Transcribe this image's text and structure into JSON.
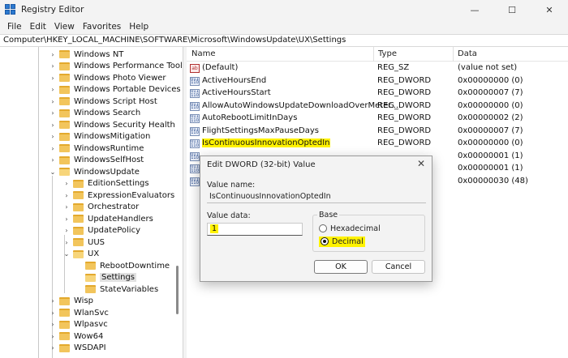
{
  "window": {
    "title": "Registry Editor",
    "min_glyph": "—",
    "max_glyph": "☐",
    "close_glyph": "✕"
  },
  "menu": [
    "File",
    "Edit",
    "View",
    "Favorites",
    "Help"
  ],
  "address": "Computer\\HKEY_LOCAL_MACHINE\\SOFTWARE\\Microsoft\\WindowsUpdate\\UX\\Settings",
  "tree": [
    {
      "label": "Windows NT",
      "level": 0,
      "expanded": false
    },
    {
      "label": "Windows Performance Toolkit",
      "level": 0,
      "expanded": false
    },
    {
      "label": "Windows Photo Viewer",
      "level": 0,
      "expanded": false
    },
    {
      "label": "Windows Portable Devices",
      "level": 0,
      "expanded": false
    },
    {
      "label": "Windows Script Host",
      "level": 0,
      "expanded": false
    },
    {
      "label": "Windows Search",
      "level": 0,
      "expanded": false
    },
    {
      "label": "Windows Security Health",
      "level": 0,
      "expanded": false
    },
    {
      "label": "WindowsMitigation",
      "level": 0,
      "expanded": false
    },
    {
      "label": "WindowsRuntime",
      "level": 0,
      "expanded": false
    },
    {
      "label": "WindowsSelfHost",
      "level": 0,
      "expanded": false
    },
    {
      "label": "WindowsUpdate",
      "level": 0,
      "expanded": true
    },
    {
      "label": "EditionSettings",
      "level": 1,
      "expanded": false
    },
    {
      "label": "ExpressionEvaluators",
      "level": 1,
      "expanded": false
    },
    {
      "label": "Orchestrator",
      "level": 1,
      "expanded": false
    },
    {
      "label": "UpdateHandlers",
      "level": 1,
      "expanded": false
    },
    {
      "label": "UpdatePolicy",
      "level": 1,
      "expanded": false
    },
    {
      "label": "UUS",
      "level": 1,
      "expanded": false
    },
    {
      "label": "UX",
      "level": 1,
      "expanded": true
    },
    {
      "label": "RebootDowntime",
      "level": 2,
      "leaf": true
    },
    {
      "label": "Settings",
      "level": 2,
      "leaf": true,
      "selected": true
    },
    {
      "label": "StateVariables",
      "level": 2,
      "leaf": true
    },
    {
      "label": "Wisp",
      "level": 0,
      "expanded": false
    },
    {
      "label": "WlanSvc",
      "level": 0,
      "expanded": false
    },
    {
      "label": "Wlpasvc",
      "level": 0,
      "expanded": false
    },
    {
      "label": "Wow64",
      "level": 0,
      "expanded": false
    },
    {
      "label": "WSDAPI",
      "level": 0,
      "expanded": false
    }
  ],
  "list": {
    "columns": [
      "Name",
      "Type",
      "Data"
    ],
    "rows": [
      {
        "name": "(Default)",
        "type": "REG_SZ",
        "data": "(value not set)",
        "icon": "string-value-icon"
      },
      {
        "name": "ActiveHoursEnd",
        "type": "REG_DWORD",
        "data": "0x00000000 (0)",
        "icon": "dword-value-icon"
      },
      {
        "name": "ActiveHoursStart",
        "type": "REG_DWORD",
        "data": "0x00000007 (7)",
        "icon": "dword-value-icon"
      },
      {
        "name": "AllowAutoWindowsUpdateDownloadOverMeter...",
        "type": "REG_DWORD",
        "data": "0x00000000 (0)",
        "icon": "dword-value-icon"
      },
      {
        "name": "AutoRebootLimitInDays",
        "type": "REG_DWORD",
        "data": "0x00000002 (2)",
        "icon": "dword-value-icon"
      },
      {
        "name": "FlightSettingsMaxPauseDays",
        "type": "REG_DWORD",
        "data": "0x00000007 (7)",
        "icon": "dword-value-icon"
      },
      {
        "name": "IsContinuousInnovationOptedIn",
        "type": "REG_DWORD",
        "data": "0x00000000 (0)",
        "icon": "dword-value-icon",
        "highlight": true
      },
      {
        "name": "",
        "type": "",
        "data": "0x00000001 (1)",
        "icon": "dword-value-icon"
      },
      {
        "name": "",
        "type": "",
        "data": "0x00000001 (1)",
        "icon": "dword-value-icon"
      },
      {
        "name": "",
        "type": "",
        "data": "0x00000030 (48)",
        "icon": "dword-value-icon"
      }
    ]
  },
  "dialog": {
    "title": "Edit DWORD (32-bit) Value",
    "close_glyph": "✕",
    "value_name_label": "Value name:",
    "value_name": "IsContinuousInnovationOptedIn",
    "value_data_label": "Value data:",
    "value_data": "1",
    "base_label": "Base",
    "hex_label": "Hexadecimal",
    "dec_label": "Decimal",
    "base_selected": "Decimal",
    "ok_label": "OK",
    "cancel_label": "Cancel"
  }
}
